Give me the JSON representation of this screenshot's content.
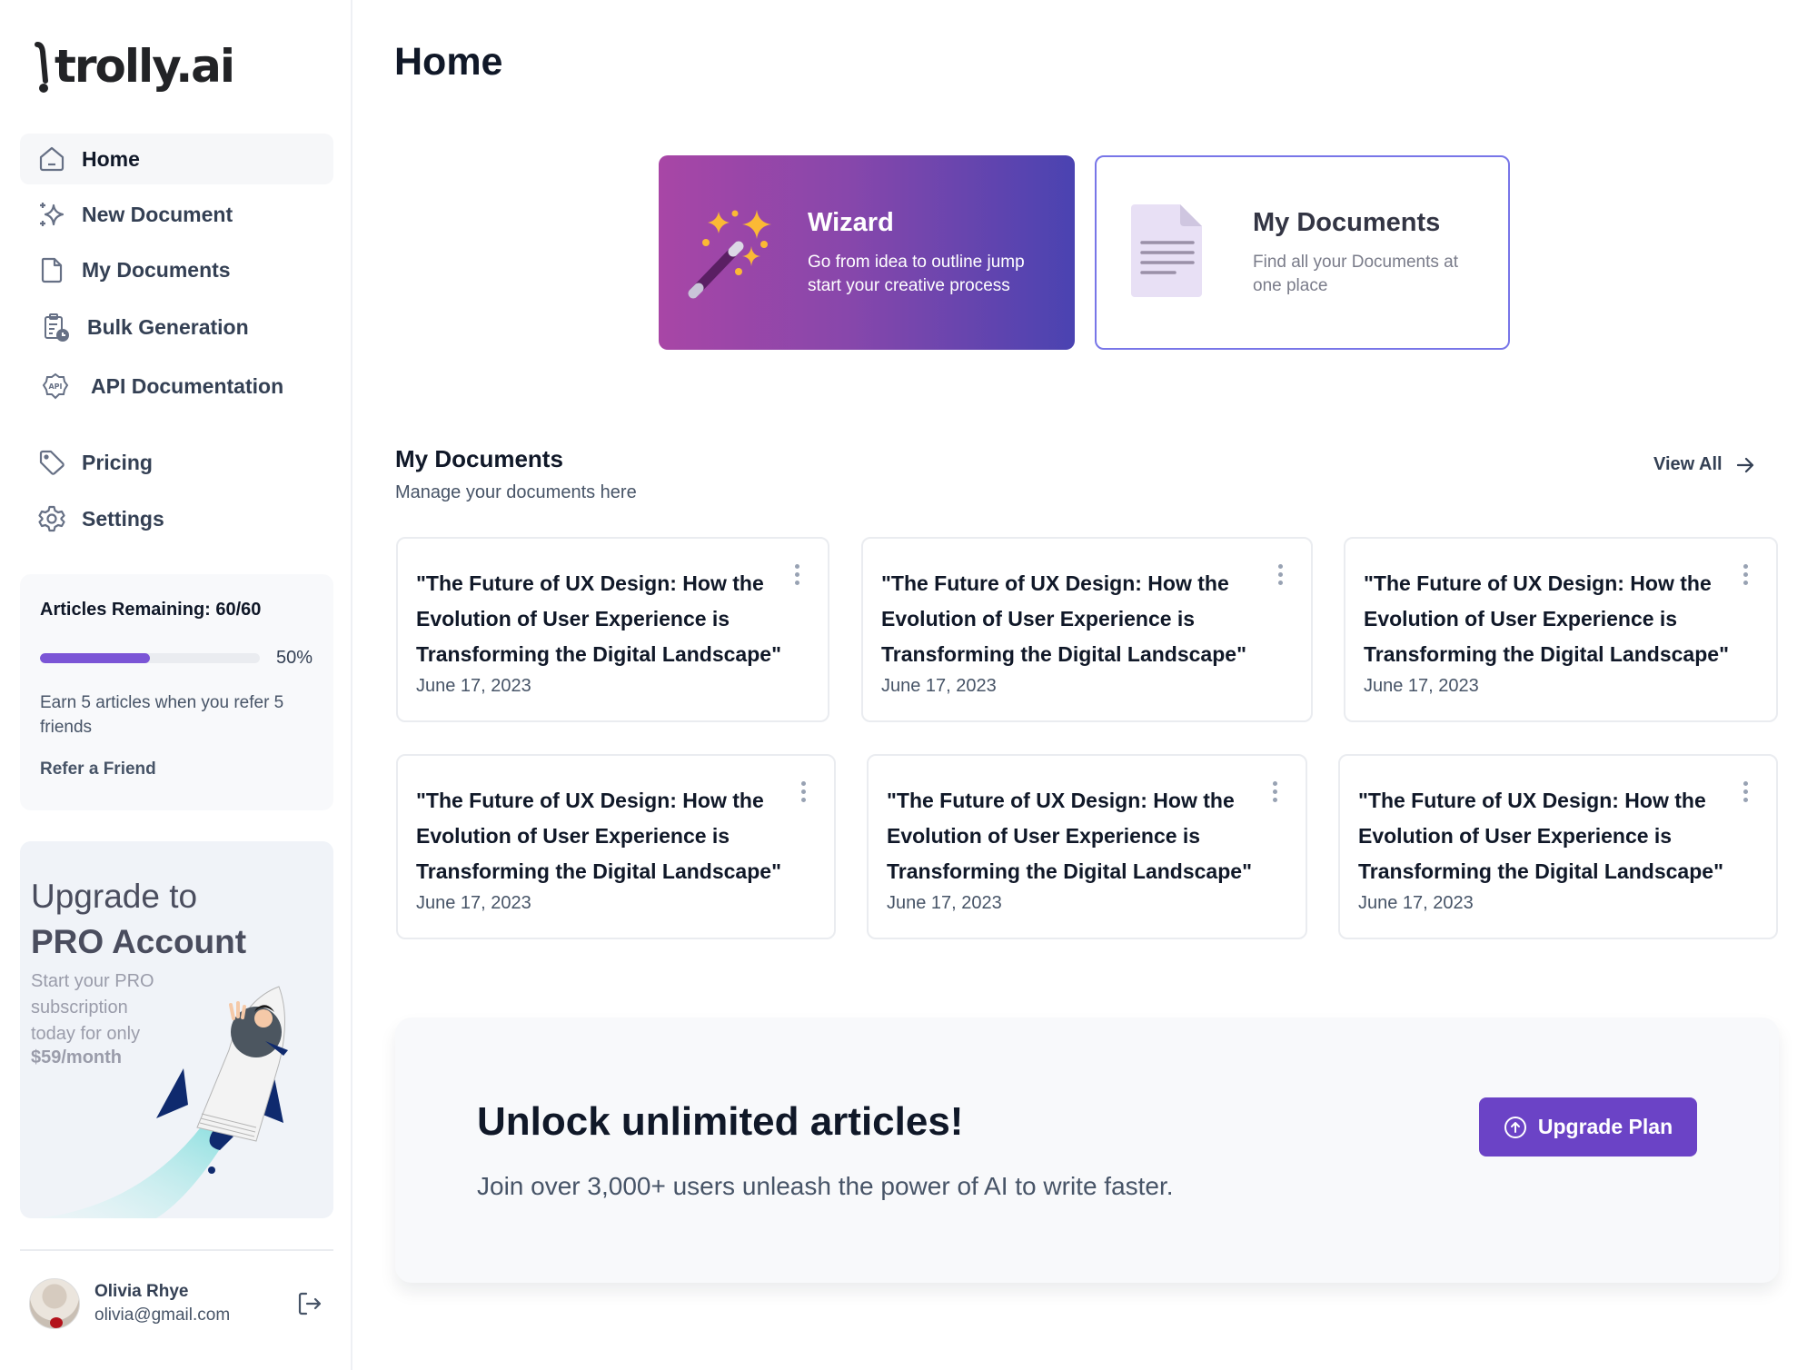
{
  "brand": {
    "name": "trolly.ai",
    "icon": "cart-logo-icon"
  },
  "sidebar": {
    "items": [
      {
        "label": "Home",
        "icon": "home-icon",
        "active": true
      },
      {
        "label": "New Document",
        "icon": "sparkle-icon"
      },
      {
        "label": "My Documents",
        "icon": "file-icon"
      },
      {
        "label": "Bulk Generation",
        "icon": "clipboard-clock-icon"
      },
      {
        "label": "API Documentation",
        "icon": "api-badge-icon"
      },
      {
        "label": "Pricing",
        "icon": "tag-icon"
      },
      {
        "label": "Settings",
        "icon": "gear-icon"
      }
    ],
    "articles": {
      "title": "Articles Remaining: 60/60",
      "progress_percent": 50,
      "progress_label": "50%",
      "description": "Earn 5 articles when you refer 5 friends",
      "link": "Refer a Friend"
    },
    "upgrade": {
      "line1": "Upgrade to",
      "line2": "PRO Account",
      "description": "Start your PRO subscription today for only",
      "price": "$59/month",
      "illustration": "rocket-illustration"
    },
    "user": {
      "name": "Olivia Rhye",
      "email": "olivia@gmail.com",
      "logout_icon": "logout-icon"
    }
  },
  "main": {
    "title": "Home",
    "quick_actions": [
      {
        "title": "Wizard",
        "description": "Go from idea to outline jump start your creative process",
        "icon": "magic-wand-icon"
      },
      {
        "title": "My Documents",
        "description": "Find all your Documents at one place",
        "icon": "document-icon"
      }
    ],
    "documents_section": {
      "title": "My Documents",
      "subtitle": "Manage your documents here",
      "view_all": "View All",
      "cards": [
        {
          "title": "\"The Future of UX Design: How the Evolution of User Experience is Transforming the Digital Landscape\"",
          "date": "June 17, 2023"
        },
        {
          "title": "\"The Future of UX Design: How the Evolution of User Experience is Transforming the Digital Landscape\"",
          "date": "June 17, 2023"
        },
        {
          "title": "\"The Future of UX Design: How the Evolution of User Experience is Transforming the Digital Landscape\"",
          "date": "June 17, 2023"
        },
        {
          "title": "\"The Future of UX Design: How the Evolution of User Experience is Transforming the Digital Landscape\"",
          "date": "June 17, 2023"
        },
        {
          "title": "\"The Future of UX Design: How the Evolution of User Experience is Transforming the Digital Landscape\"",
          "date": "June 17, 2023"
        },
        {
          "title": "\"The Future of UX Design: How the Evolution of User Experience is Transforming the Digital Landscape\"",
          "date": "June 17, 2023"
        }
      ]
    },
    "banner": {
      "title": "Unlock unlimited articles!",
      "subtitle": "Join over 3,000+ users unleash the power of AI to write faster.",
      "button": "Upgrade Plan"
    }
  },
  "colors": {
    "accent": "#6b43c6",
    "progress": "#7b55d6",
    "wizard_gradient_start": "#a846a6",
    "wizard_gradient_end": "#4a43b1",
    "docs_card_border": "#7876e8"
  }
}
